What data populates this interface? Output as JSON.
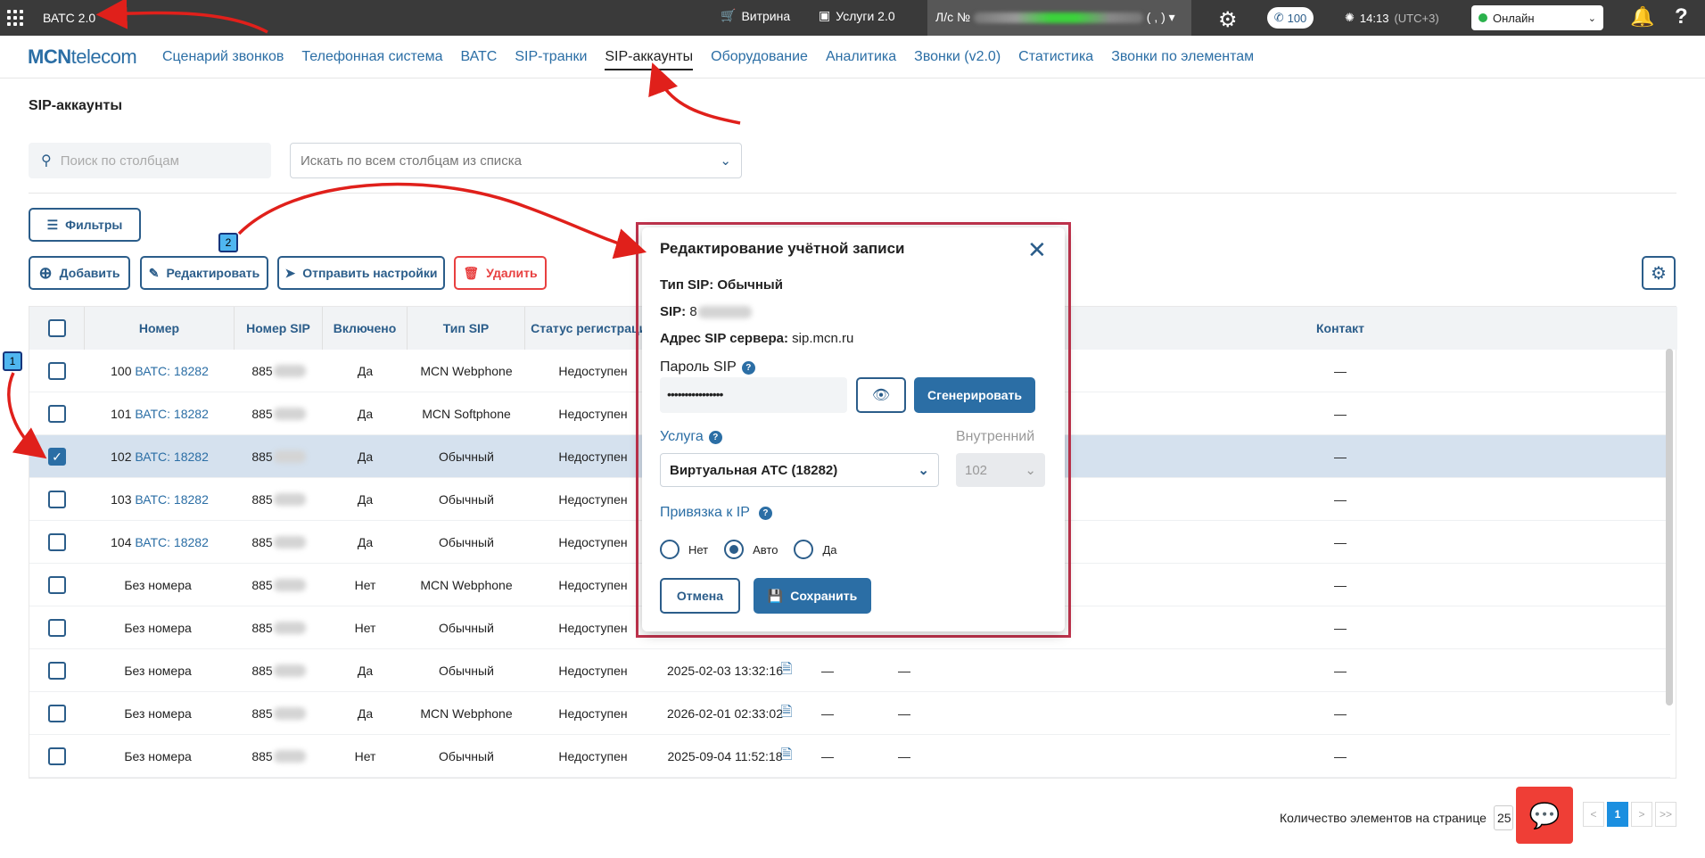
{
  "topbar": {
    "app_title": "ВАТС 2.0",
    "vitrina": "Витрина",
    "uslugi": "Услуги 2.0",
    "account_prefix": "Л/с №",
    "account_suffix": "( , )",
    "phone_count": "100",
    "time": "14:13",
    "timezone": "(UTC+3)",
    "status": "Онлайн"
  },
  "nav": {
    "logo_bold": "MCN",
    "logo_rest": "telecom",
    "items": [
      "Сценарий звонков",
      "Телефонная система",
      "ВАТС",
      "SIP-транки",
      "SIP-аккаунты",
      "Оборудование",
      "Аналитика",
      "Звонки (v2.0)",
      "Статистика",
      "Звонки по элементам"
    ],
    "active_index": 4
  },
  "page_title": "SIP-аккаунты",
  "search": {
    "placeholder": "Поиск по столбцам",
    "column_select_placeholder": "Искать по всем столбцам из списка"
  },
  "buttons": {
    "filters": "Фильтры",
    "add": "Добавить",
    "edit": "Редактировать",
    "send": "Отправить настройки",
    "delete": "Удалить"
  },
  "table": {
    "headers": [
      "Номер",
      "Номер SIP",
      "Включено",
      "Тип SIP",
      "Статус регистрации",
      "Контакт"
    ],
    "rows": [
      {
        "num": "100",
        "vats": "ВАТС: 18282",
        "sip": "885",
        "on": "Да",
        "type": "MCN Webphone",
        "status": "Недоступен",
        "date": "",
        "c1": "",
        "c2": "",
        "contact": "—",
        "selected": false
      },
      {
        "num": "101",
        "vats": "ВАТС: 18282",
        "sip": "885",
        "on": "Да",
        "type": "MCN Softphone",
        "status": "Недоступен",
        "date": "",
        "c1": "",
        "c2": "",
        "contact": "—",
        "selected": false
      },
      {
        "num": "102",
        "vats": "ВАТС: 18282",
        "sip": "885",
        "on": "Да",
        "type": "Обычный",
        "status": "Недоступен",
        "date": "",
        "c1": "",
        "c2": "",
        "contact": "—",
        "selected": true
      },
      {
        "num": "103",
        "vats": "ВАТС: 18282",
        "sip": "885",
        "on": "Да",
        "type": "Обычный",
        "status": "Недоступен",
        "date": "",
        "c1": "",
        "c2": "",
        "contact": "—",
        "selected": false
      },
      {
        "num": "104",
        "vats": "ВАТС: 18282",
        "sip": "885",
        "on": "Да",
        "type": "Обычный",
        "status": "Недоступен",
        "date": "",
        "c1": "",
        "c2": "",
        "contact": "—",
        "selected": false
      },
      {
        "num": "Без номера",
        "vats": "",
        "sip": "885",
        "on": "Нет",
        "type": "MCN Webphone",
        "status": "Недоступен",
        "date": "",
        "c1": "",
        "c2": "",
        "contact": "—",
        "selected": false
      },
      {
        "num": "Без номера",
        "vats": "",
        "sip": "885",
        "on": "Нет",
        "type": "Обычный",
        "status": "Недоступен",
        "date": "",
        "c1": "",
        "c2": "",
        "contact": "—",
        "selected": false
      },
      {
        "num": "Без номера",
        "vats": "",
        "sip": "885",
        "on": "Да",
        "type": "Обычный",
        "status": "Недоступен",
        "date": "2025-02-03 13:32:16",
        "c1": "—",
        "c2": "—",
        "contact": "—",
        "selected": false
      },
      {
        "num": "Без номера",
        "vats": "",
        "sip": "885",
        "on": "Да",
        "type": "MCN Webphone",
        "status": "Недоступен",
        "date": "2026-02-01 02:33:02",
        "c1": "—",
        "c2": "—",
        "contact": "—",
        "selected": false
      },
      {
        "num": "Без номера",
        "vats": "",
        "sip": "885",
        "on": "Нет",
        "type": "Обычный",
        "status": "Недоступен",
        "date": "2025-09-04 11:52:18",
        "c1": "—",
        "c2": "—",
        "contact": "—",
        "selected": false
      }
    ]
  },
  "pager": {
    "label": "Количество элементов на странице",
    "page_size": "25",
    "prev": "<",
    "first_prev": "<<",
    "current": "1",
    "next": ">",
    "last": ">>"
  },
  "modal": {
    "title": "Редактирование учётной записи",
    "type_label": "Тип SIP:",
    "type_value": "Обычный",
    "sip_label": "SIP:",
    "sip_value": "8",
    "server_label": "Адрес SIP сервера:",
    "server_value": "sip.mcn.ru",
    "password_label": "Пароль SIP",
    "password_value": "••••••••••••••••",
    "generate": "Сгенерировать",
    "service_label": "Услуга",
    "service_value": "Виртуальная АТС (18282)",
    "internal_label": "Внутренний",
    "internal_value": "102",
    "ip_label": "Привязка к IP",
    "radio_no": "Нет",
    "radio_auto": "Авто",
    "radio_yes": "Да",
    "cancel": "Отмена",
    "save": "Сохранить"
  },
  "annotations": {
    "step1": "1",
    "step2": "2"
  },
  "colors": {
    "accent": "#2b6ea5",
    "dark_accent": "#2b5d8a",
    "danger": "#e84040",
    "topbar": "#3a3a3a",
    "highlight_frame": "#c0334d",
    "arrow": "#e0201b"
  }
}
